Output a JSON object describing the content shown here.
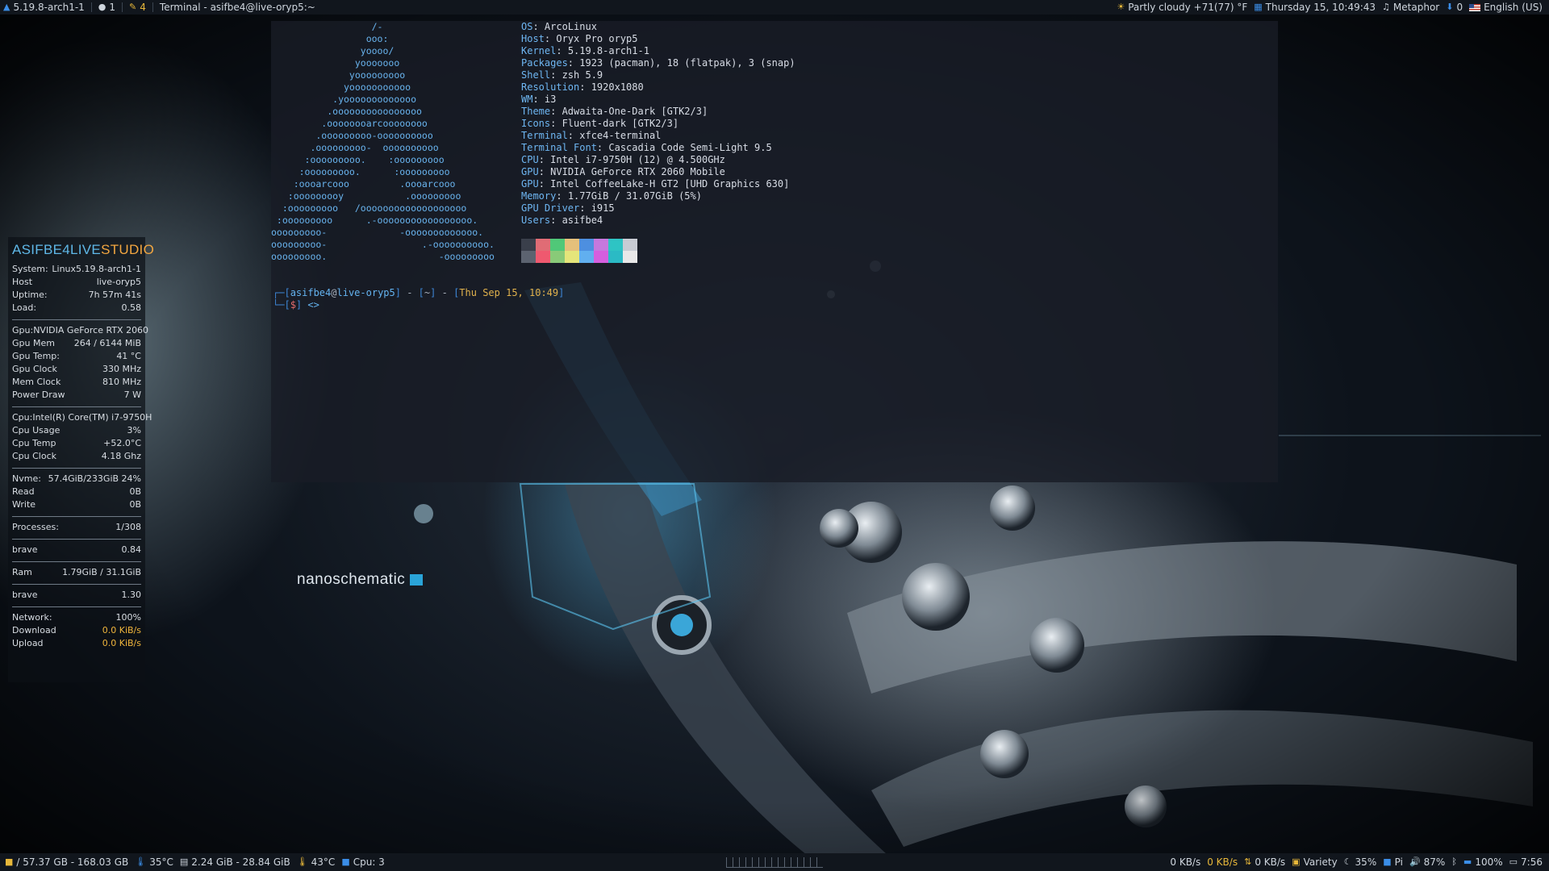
{
  "topbar": {
    "kernel": "5.19.8-arch1-1",
    "users_count": "1",
    "updates_count": "4",
    "window_title": "Terminal - asifbe4@live-oryp5:~",
    "weather": "Partly cloudy +71(77) °F",
    "datetime": "Thursday 15, 10:49:43",
    "player": "Metaphor",
    "downloads_count": "0",
    "keyboard_layout": "English (US)"
  },
  "terminal": {
    "ascii_art": "                  /-\n                 ooo:\n                yoooo/\n               yooooooo\n              yooooooooo\n             yooooooooooo\n           .yooooooooooooo\n          .oooooooooooooooo\n         .oooooooarcoooooooo\n        .ooooooooo-oooooooooo\n       .ooooooooo-  oooooooooo\n      :ooooooooo.    :ooooooooo\n     :ooooooooo.      :ooooooooo\n    :oooarcooo         .oooarcooo\n   :ooooooooy           .ooooooooo\n  :ooooooooo   /ooooooooooooooooooo\n :ooooooooo      .-ooooooooooooooooo.\nooooooooo-             -ooooooooooooo.\nooooooooo-                 .-oooooooooo.\nooooooooo.                    -ooooooooo",
    "info": [
      {
        "key": "OS",
        "value": "ArcoLinux"
      },
      {
        "key": "Host",
        "value": "Oryx Pro oryp5"
      },
      {
        "key": "Kernel",
        "value": "5.19.8-arch1-1"
      },
      {
        "key": "Packages",
        "value": "1923 (pacman), 18 (flatpak), 3 (snap)"
      },
      {
        "key": "Shell",
        "value": "zsh 5.9"
      },
      {
        "key": "Resolution",
        "value": "1920x1080"
      },
      {
        "key": "WM",
        "value": "i3"
      },
      {
        "key": "Theme",
        "value": "Adwaita-One-Dark [GTK2/3]"
      },
      {
        "key": "Icons",
        "value": "Fluent-dark [GTK2/3]"
      },
      {
        "key": "Terminal",
        "value": "xfce4-terminal"
      },
      {
        "key": "Terminal Font",
        "value": "Cascadia Code Semi-Light 9.5"
      },
      {
        "key": "CPU",
        "value": "Intel i7-9750H (12) @ 4.500GHz"
      },
      {
        "key": "GPU",
        "value": "NVIDIA GeForce RTX 2060 Mobile"
      },
      {
        "key": "GPU",
        "value": "Intel CoffeeLake-H GT2 [UHD Graphics 630]"
      },
      {
        "key": "Memory",
        "value": "1.77GiB / 31.07GiB (5%)"
      },
      {
        "key": "GPU Driver",
        "value": "i915"
      },
      {
        "key": "Users",
        "value": "asifbe4"
      }
    ],
    "palette": [
      "#3a3f4b",
      "#e06c75",
      "#50c878",
      "#e5c07b",
      "#4d8fe0",
      "#c678dd",
      "#2ec4c4",
      "#c8ccd4",
      "#5c6370",
      "#ef596f",
      "#89ca78",
      "#e5e57a",
      "#61afef",
      "#d55fde",
      "#2bbac5",
      "#e8e8e8"
    ],
    "prompt": {
      "user": "asifbe4",
      "host": "live-oryp5",
      "dir": "~",
      "date": "Thu Sep 15, 10:49",
      "sign": "$",
      "tail": "<>"
    }
  },
  "conky": {
    "brand_a": "ASIFBE4LIVE",
    "brand_b": "STUDIO",
    "system": [
      {
        "label": "System:",
        "value": "Linux5.19.8-arch1-1"
      },
      {
        "label": "Host",
        "value": "live-oryp5"
      },
      {
        "label": "Uptime:",
        "value": "7h 57m 41s"
      },
      {
        "label": "Load:",
        "value": "0.58"
      }
    ],
    "gpu": [
      {
        "label": "Gpu:",
        "value": "NVIDIA GeForce RTX 2060"
      },
      {
        "label": "Gpu Mem",
        "value": "264 / 6144 MiB"
      },
      {
        "label": "Gpu Temp:",
        "value": "41 °C"
      },
      {
        "label": "Gpu Clock",
        "value": "330 MHz"
      },
      {
        "label": "Mem Clock",
        "value": "810 MHz"
      },
      {
        "label": "Power Draw",
        "value": "7 W"
      }
    ],
    "cpu": [
      {
        "label": "Cpu:",
        "value": "Intel(R) Core(TM) i7-9750H"
      },
      {
        "label": "Cpu Usage",
        "value": "3%"
      },
      {
        "label": "Cpu Temp",
        "value": "+52.0°C"
      },
      {
        "label": "Cpu Clock",
        "value": "4.18 Ghz"
      }
    ],
    "disk": [
      {
        "label": "Nvme:",
        "value": "57.4GiB/233GiB 24%"
      },
      {
        "label": "Read",
        "value": "0B"
      },
      {
        "label": "Write",
        "value": "0B"
      }
    ],
    "processes": {
      "label": "Processes:",
      "value": "1/308"
    },
    "top_cpu": {
      "label": "brave",
      "value": "0.84"
    },
    "ram": {
      "label": "Ram",
      "value": "1.79GiB / 31.1GiB"
    },
    "top_mem": {
      "label": "brave",
      "value": "1.30"
    },
    "network": [
      {
        "label": "Network:",
        "value": "100%"
      },
      {
        "label": "Download",
        "value": "0.0 KiB/s"
      },
      {
        "label": "Upload",
        "value": "0.0 KiB/s"
      }
    ]
  },
  "wallpaper": {
    "brand": "nanoschematic"
  },
  "bottombar": {
    "disk": "/ 57.37 GB - 168.03 GB",
    "temp1": "35°C",
    "mem": "2.24 GiB - 28.84 GiB",
    "temp2": "43°C",
    "cpu": "Cpu: 3",
    "net_up": "0 KB/s",
    "net_down": "0 KB/s",
    "net_total": "0 KB/s",
    "variety": "Variety",
    "brightness": "35%",
    "pi": "Pi",
    "volume": "87%",
    "battery": "100%",
    "time": "7:56"
  },
  "colors": {
    "accent_blue": "#5fb8e8",
    "accent_orange": "#f2a640",
    "terminal_key": "#6eb6f2",
    "bar_bg": "#11161d"
  }
}
